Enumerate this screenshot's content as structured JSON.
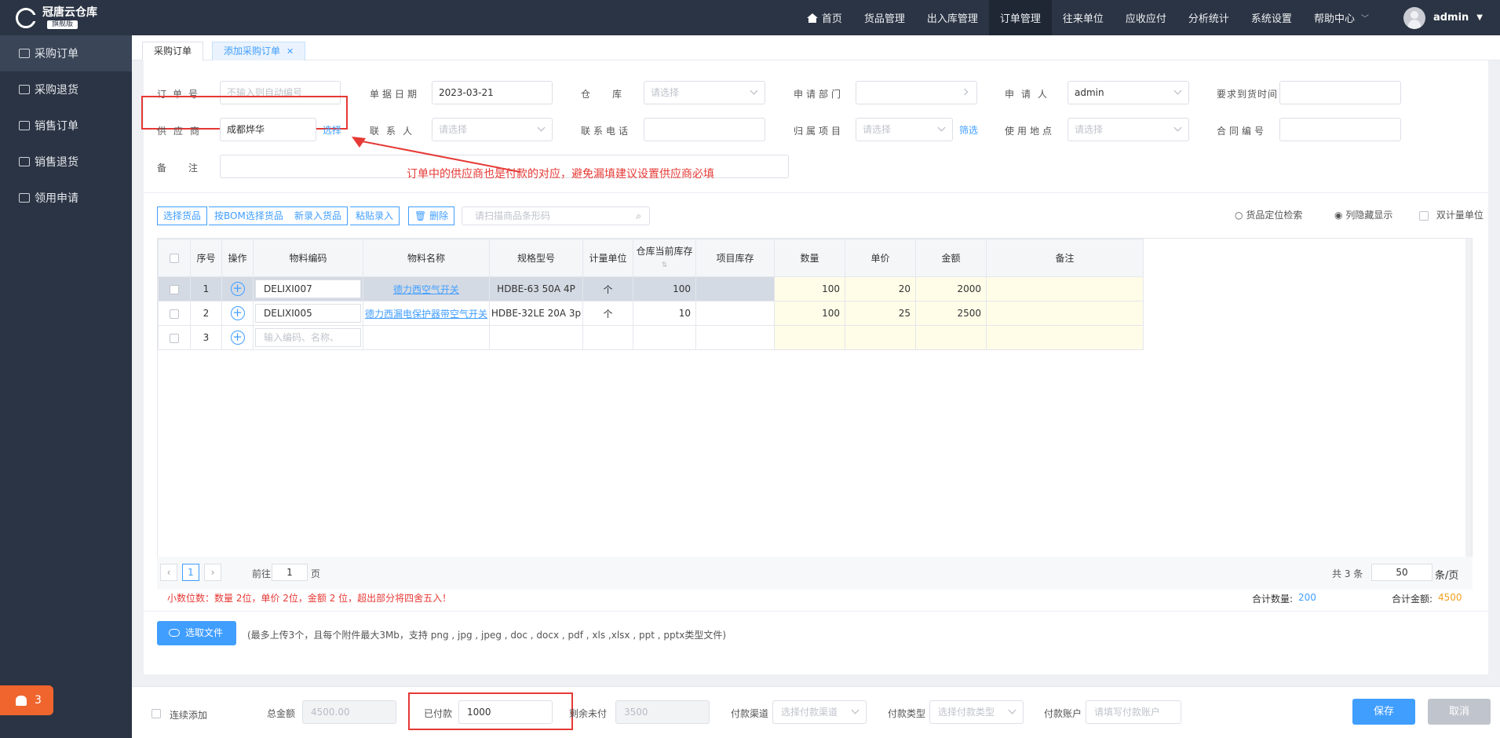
{
  "app": {
    "title": "冠唐云仓库",
    "edition": "旗舰版"
  },
  "sidebar": {
    "items": [
      {
        "label": "采购订单"
      },
      {
        "label": "采购退货"
      },
      {
        "label": "销售订单"
      },
      {
        "label": "销售退货"
      },
      {
        "label": "领用申请"
      }
    ],
    "notification_count": "3"
  },
  "nav": {
    "items": [
      "首页",
      "货品管理",
      "出入库管理",
      "订单管理",
      "往来单位",
      "应收应付",
      "分析统计",
      "系统设置",
      "帮助中心"
    ],
    "user": "admin"
  },
  "tabs": [
    {
      "label": "采购订单"
    },
    {
      "label": "添加采购订单"
    }
  ],
  "form": {
    "order_no": {
      "label": "订单号",
      "placeholder": "不输入则自动编号"
    },
    "doc_date": {
      "label": "单据日期",
      "value": "2023-03-21"
    },
    "warehouse": {
      "label": "仓库",
      "placeholder": "请选择"
    },
    "dept": {
      "label": "申请部门",
      "value": ""
    },
    "applicant": {
      "label": "申请人",
      "value": "admin"
    },
    "delivery_time": {
      "label": "要求到货时间",
      "value": ""
    },
    "supplier": {
      "label": "供应商",
      "value": "成都烨华",
      "action": "选择"
    },
    "contact": {
      "label": "联系人",
      "placeholder": "请选择"
    },
    "phone": {
      "label": "联系电话",
      "value": ""
    },
    "project": {
      "label": "归属项目",
      "placeholder": "请选择",
      "action": "筛选"
    },
    "location": {
      "label": "使用地点",
      "placeholder": "请选择"
    },
    "contract_no": {
      "label": "合同编号",
      "value": ""
    },
    "remark": {
      "label": "备注",
      "value": ""
    },
    "annotation": "订单中的供应商也是付款的对应，避免漏填建议设置供应商必填"
  },
  "toolbar": {
    "select_goods": "选择货品",
    "bom_select": "按BOM选择货品",
    "new_goods": "新录入货品",
    "paste": "粘贴录入",
    "delete": "删除",
    "scan_placeholder": "请扫描商品条形码",
    "locate": "货品定位检索",
    "hide_cols": "列隐藏显示",
    "dual_unit": "双计量单位"
  },
  "table": {
    "headers": [
      "序号",
      "操作",
      "物料编码",
      "物料名称",
      "规格型号",
      "计量单位",
      "仓库当前库存",
      "项目库存",
      "数量",
      "单价",
      "金额",
      "备注"
    ],
    "rows": [
      {
        "no": "1",
        "code": "DELIXI007",
        "name": "德力西空气开关",
        "spec": "HDBE-63 50A 4P",
        "unit": "个",
        "stock": "100",
        "project_stock": "",
        "qty": "100",
        "price": "20",
        "amount": "2000",
        "remark": ""
      },
      {
        "no": "2",
        "code": "DELIXI005",
        "name": "德力西漏电保护器带空气开关",
        "spec": "HDBE-32LE 20A 3p",
        "unit": "个",
        "stock": "10",
        "project_stock": "",
        "qty": "100",
        "price": "25",
        "amount": "2500",
        "remark": ""
      },
      {
        "no": "3",
        "code_placeholder": "输入编码、名称、"
      }
    ]
  },
  "pager": {
    "current": "1",
    "goto_prefix": "前往",
    "goto_value": "1",
    "goto_suffix": "页",
    "total": "共 3 条",
    "page_size": "50",
    "page_size_suffix": "条/页"
  },
  "summary": {
    "precision_note": "小数位数：数量 2位，单价 2位，金额 2 位，超出部分将四舍五入！",
    "total_qty_label": "合计数量:",
    "total_qty": "200",
    "total_amount_label": "合计金额:",
    "total_amount": "4500"
  },
  "upload": {
    "button": "选取文件",
    "hint": "(最多上传3个，且每个附件最大3Mb，支持 png , jpg , jpeg , doc , docx , pdf , xls ,xlsx , ppt , pptx类型文件)"
  },
  "bottom": {
    "continuous_add": "连续添加",
    "total_label": "总金额",
    "total_value": "4500.00",
    "paid_label": "已付款",
    "paid_value": "1000",
    "remaining_label": "剩余未付",
    "remaining_value": "3500",
    "channel_label": "付款渠道",
    "channel_placeholder": "选择付款渠道",
    "type_label": "付款类型",
    "type_placeholder": "选择付款类型",
    "account_label": "付款账户",
    "account_placeholder": "请填写付款账户",
    "save": "保存",
    "cancel": "取消"
  },
  "colors": {
    "primary": "#409eff",
    "sidebar": "#2b3444",
    "highlight_red": "#e53935",
    "badge_orange": "#f0652e"
  }
}
